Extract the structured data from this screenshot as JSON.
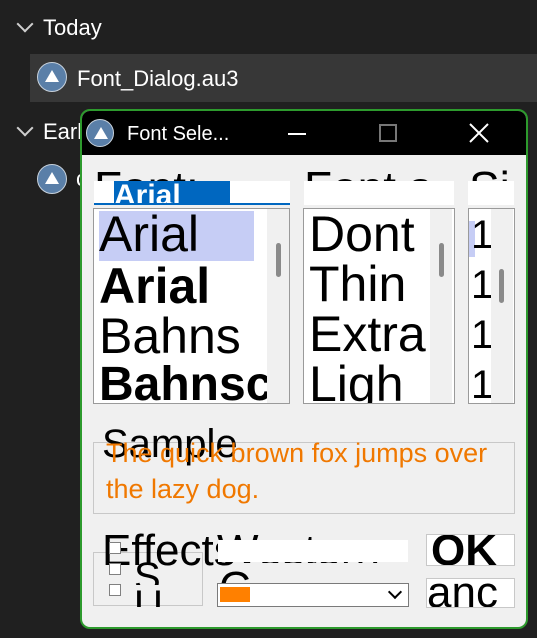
{
  "explorer": {
    "group_today": "Today",
    "file_name": "Font_Dialog.au3",
    "group_earlier": "Earl",
    "partial_item": "c"
  },
  "dialog": {
    "title": "Font Sele...",
    "font_label": "Font:",
    "font_input_value": "Arial",
    "font_list": [
      "Arial",
      "Arial",
      "Bahns",
      "Bahnsch"
    ],
    "style_label": "Font s",
    "style_list": [
      "Dont",
      "Thin",
      "Extra",
      "Ligh"
    ],
    "size_label": "Si",
    "size_list": [
      "1",
      "1",
      "1",
      "1"
    ],
    "sample_label": "Sample",
    "sample_text": "The quick brown fox jumps over the lazy dog.",
    "effects_label": "Effects",
    "effects_checkbox_labels": [
      "S",
      "U"
    ],
    "script_label": "Western",
    "color_label": "C",
    "ok_label": "OK",
    "cancel_label": "anc"
  },
  "colors": {
    "sample_text": "#f07800",
    "selection": "#c6cdf5",
    "window_border": "#2d9a2d"
  }
}
